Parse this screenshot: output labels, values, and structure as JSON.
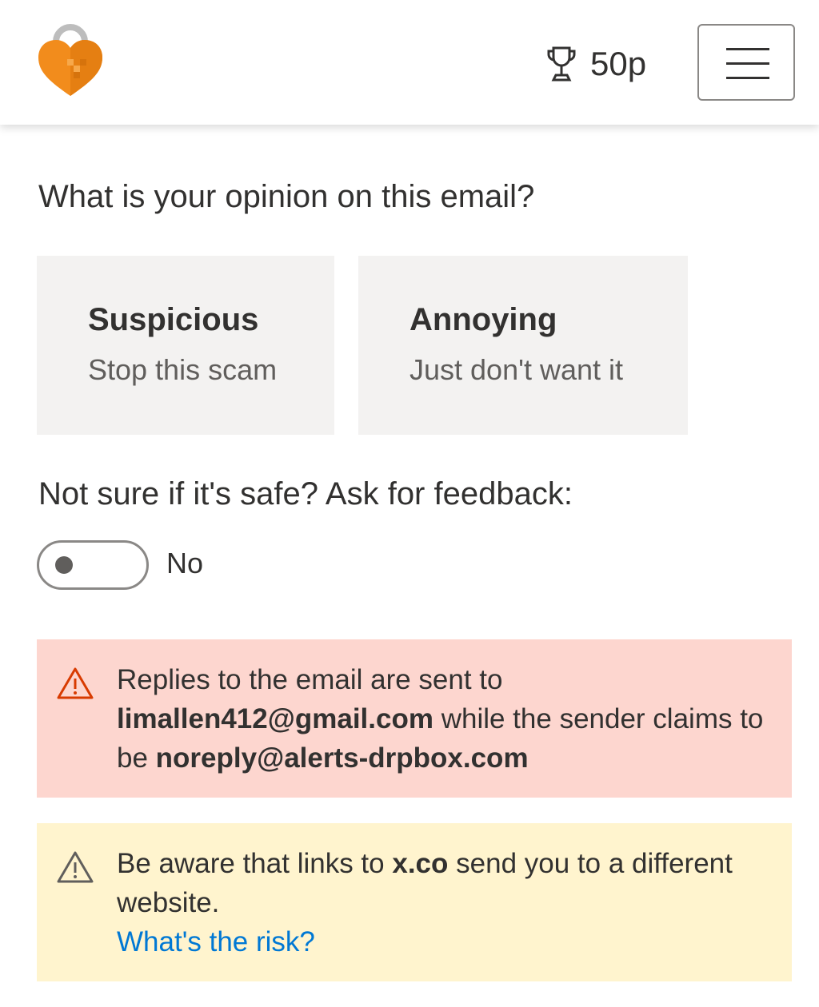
{
  "header": {
    "logo_icon": "heart-padlock-icon",
    "points_icon": "trophy-icon",
    "points": "50p",
    "menu_icon": "hamburger-menu-icon"
  },
  "question": "What is your opinion on this email?",
  "options": [
    {
      "title": "Suspicious",
      "subtitle": "Stop this scam"
    },
    {
      "title": "Annoying",
      "subtitle": "Just don't want it"
    }
  ],
  "feedback": {
    "label": "Not sure if it's safe? Ask for feedback:",
    "toggle_value": "No",
    "toggle_on": false
  },
  "alerts": {
    "reply_to": {
      "icon": "warning-triangle-icon",
      "color": "#d83b01",
      "background": "#fdd6cf",
      "text_before": "Replies to the email are sent to",
      "reply_address": "limallen412@gmail.com",
      "text_middle": "while the sender claims to be",
      "sender_address": "noreply@alerts-drpbox.com"
    },
    "link_warning": {
      "icon": "warning-triangle-icon",
      "color": "#605e5c",
      "background": "#fff4ce",
      "text_before": "Be aware that links to",
      "domain": "x.co",
      "text_after": "send you to a different website.",
      "link_label": "What's the risk?"
    }
  },
  "colors": {
    "accent_orange": "#f28c1c",
    "link_blue": "#0078d4"
  }
}
